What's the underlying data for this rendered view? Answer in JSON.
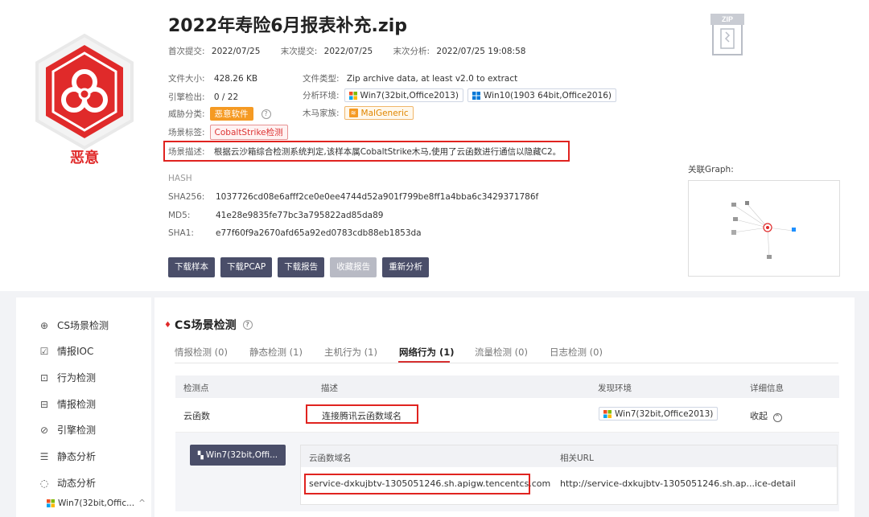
{
  "file": {
    "title": "2022年寿险6月报表补充.zip",
    "verdict": "恶意",
    "first_submit_label": "首次提交:",
    "first_submit": "2022/07/25",
    "last_submit_label": "末次提交:",
    "last_submit": "2022/07/25",
    "last_analysis_label": "末次分析:",
    "last_analysis": "2022/07/25 19:08:58",
    "size_label": "文件大小:",
    "size": "428.26 KB",
    "type_label": "文件类型:",
    "type": "Zip archive data, at least v2.0 to extract",
    "engine_label": "引擎检出:",
    "engine": "0 / 22",
    "env_label": "分析环境:",
    "env1": "Win7(32bit,Office2013)",
    "env2": "Win10(1903 64bit,Office2016)",
    "threat_label": "威胁分类:",
    "threat": "恶意软件",
    "family_label": "木马家族:",
    "family": "MalGeneric",
    "scene_tag_label": "场景标签:",
    "scene_tag": "CobaltStrike检测",
    "scene_desc_label": "场景描述:",
    "scene_desc": "根据云沙箱综合检测系统判定,该样本属CobaltStrike木马,使用了云函数进行通信以隐藏C2。",
    "zip_badge": "ZIP"
  },
  "hash": {
    "heading": "HASH",
    "sha256_label": "SHA256:",
    "sha256": "1037726cd08e6afff2ce0e0ee4744d52a901f799be8ff1a4bba6c3429371786f",
    "md5_label": "MD5:",
    "md5": "41e28e9835fe77bc3a795822ad85da89",
    "sha1_label": "SHA1:",
    "sha1": "e77f60f9a2670afd65a92ed0783cdb88eb1853da"
  },
  "actions": {
    "download_sample": "下载样本",
    "download_pcap": "下载PCAP",
    "download_report": "下载报告",
    "favorite_report": "收藏报告",
    "reanalyze": "重新分析"
  },
  "graph": {
    "label": "关联Graph:"
  },
  "sidebar": {
    "items": [
      {
        "label": "CS场景检测",
        "icon": "crosshair-icon"
      },
      {
        "label": "情报IOC",
        "icon": "checklist-icon"
      },
      {
        "label": "行为检测",
        "icon": "monitor-chart-icon"
      },
      {
        "label": "情报检测",
        "icon": "structure-icon"
      },
      {
        "label": "引擎检测",
        "icon": "gauge-icon"
      },
      {
        "label": "静态分析",
        "icon": "document-icon"
      },
      {
        "label": "动态分析",
        "icon": "loading-icon"
      }
    ],
    "sub_env": "Win7(32bit,Offic..."
  },
  "section": {
    "title": "CS场景检测",
    "tabs": [
      {
        "label": "情报检测 (0)"
      },
      {
        "label": "静态检测 (1)"
      },
      {
        "label": "主机行为 (1)"
      },
      {
        "label": "网络行为 (1)"
      },
      {
        "label": "流量检测 (0)"
      },
      {
        "label": "日志检测 (0)"
      }
    ],
    "table_headers": [
      "检测点",
      "描述",
      "发现环境",
      "详细信息"
    ],
    "row": {
      "point": "云函数",
      "desc": "连接腾讯云函数域名",
      "env": "Win7(32bit,Office2013)",
      "detail": "收起"
    },
    "sub_env_button": "Win7(32bit,Offi...",
    "sub_headers": [
      "云函数域名",
      "相关URL"
    ],
    "sub_row": {
      "domain": "service-dxkujbtv-1305051246.sh.apigw.tencentcs.com",
      "url": "http://service-dxkujbtv-1305051246.sh.ap...ice-detail"
    }
  },
  "colors": {
    "malicious_red": "#e02a2a",
    "threat_orange": "#f59a23",
    "button_dark": "#4a4e69",
    "annotation_red": "#e0231f"
  }
}
